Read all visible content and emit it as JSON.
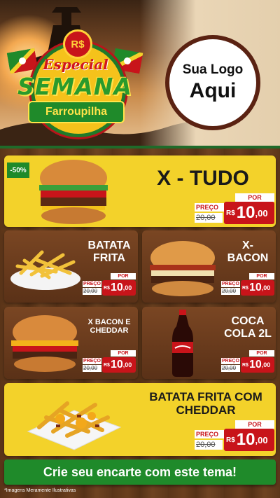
{
  "header": {
    "badge_currency": "R$",
    "badge_line1": "Especial",
    "badge_line2": "SEMANA",
    "badge_line3": "Farroupilha",
    "logo_line1": "Sua Logo",
    "logo_line2": "Aqui"
  },
  "products": [
    {
      "name": "X - TUDO",
      "discount": "-50%",
      "por_label": "POR",
      "preco_label": "PREÇO",
      "old_prefix": "de",
      "old_price": "20,00",
      "currency": "R$",
      "price": "10",
      "cents": ",00",
      "unit": "UNID"
    },
    {
      "name_l1": "BATATA",
      "name_l2": "FRITA",
      "por_label": "POR",
      "preco_label": "PREÇO",
      "old_prefix": "de",
      "old_price": "20,00",
      "currency": "R$",
      "price": "10",
      "cents": ",00",
      "unit": "POC"
    },
    {
      "name_l1": "X-",
      "name_l2": "BACON",
      "por_label": "POR",
      "preco_label": "PREÇO",
      "old_prefix": "de",
      "old_price": "20,00",
      "currency": "R$",
      "price": "10",
      "cents": ",00",
      "unit": "UNID"
    },
    {
      "name_l1": "X BACON E",
      "name_l2": "CHEDDAR",
      "por_label": "POR",
      "preco_label": "PREÇO",
      "old_prefix": "de",
      "old_price": "20,00",
      "currency": "R$",
      "price": "10",
      "cents": ",00",
      "unit": "UNID"
    },
    {
      "name_l1": "COCA",
      "name_l2": "COLA 2L",
      "por_label": "POR",
      "preco_label": "PREÇO",
      "old_prefix": "de",
      "old_price": "20,00",
      "currency": "R$",
      "price": "10",
      "cents": ",00",
      "unit": "UNID"
    },
    {
      "name_l1": "BATATA FRITA COM",
      "name_l2": "CHEDDAR",
      "por_label": "POR",
      "preco_label": "PREÇO",
      "old_prefix": "de",
      "old_price": "20,00",
      "currency": "R$",
      "price": "10",
      "cents": ",00",
      "unit": "POÇ"
    }
  ],
  "footer": {
    "cta": "Crie seu encarte com este tema!",
    "disclaimer": "*Imagens Meramente Ilustrativas"
  },
  "colors": {
    "green": "#1f8a2a",
    "yellow": "#f3d22a",
    "red": "#c8141a",
    "wood": "#5a3418"
  },
  "icons": [
    "gaucho-rider-silhouette",
    "rio-grande-flag",
    "burger",
    "fries",
    "bacon-burger",
    "cheddar-burger",
    "coca-cola-bottle",
    "cheddar-fries"
  ]
}
